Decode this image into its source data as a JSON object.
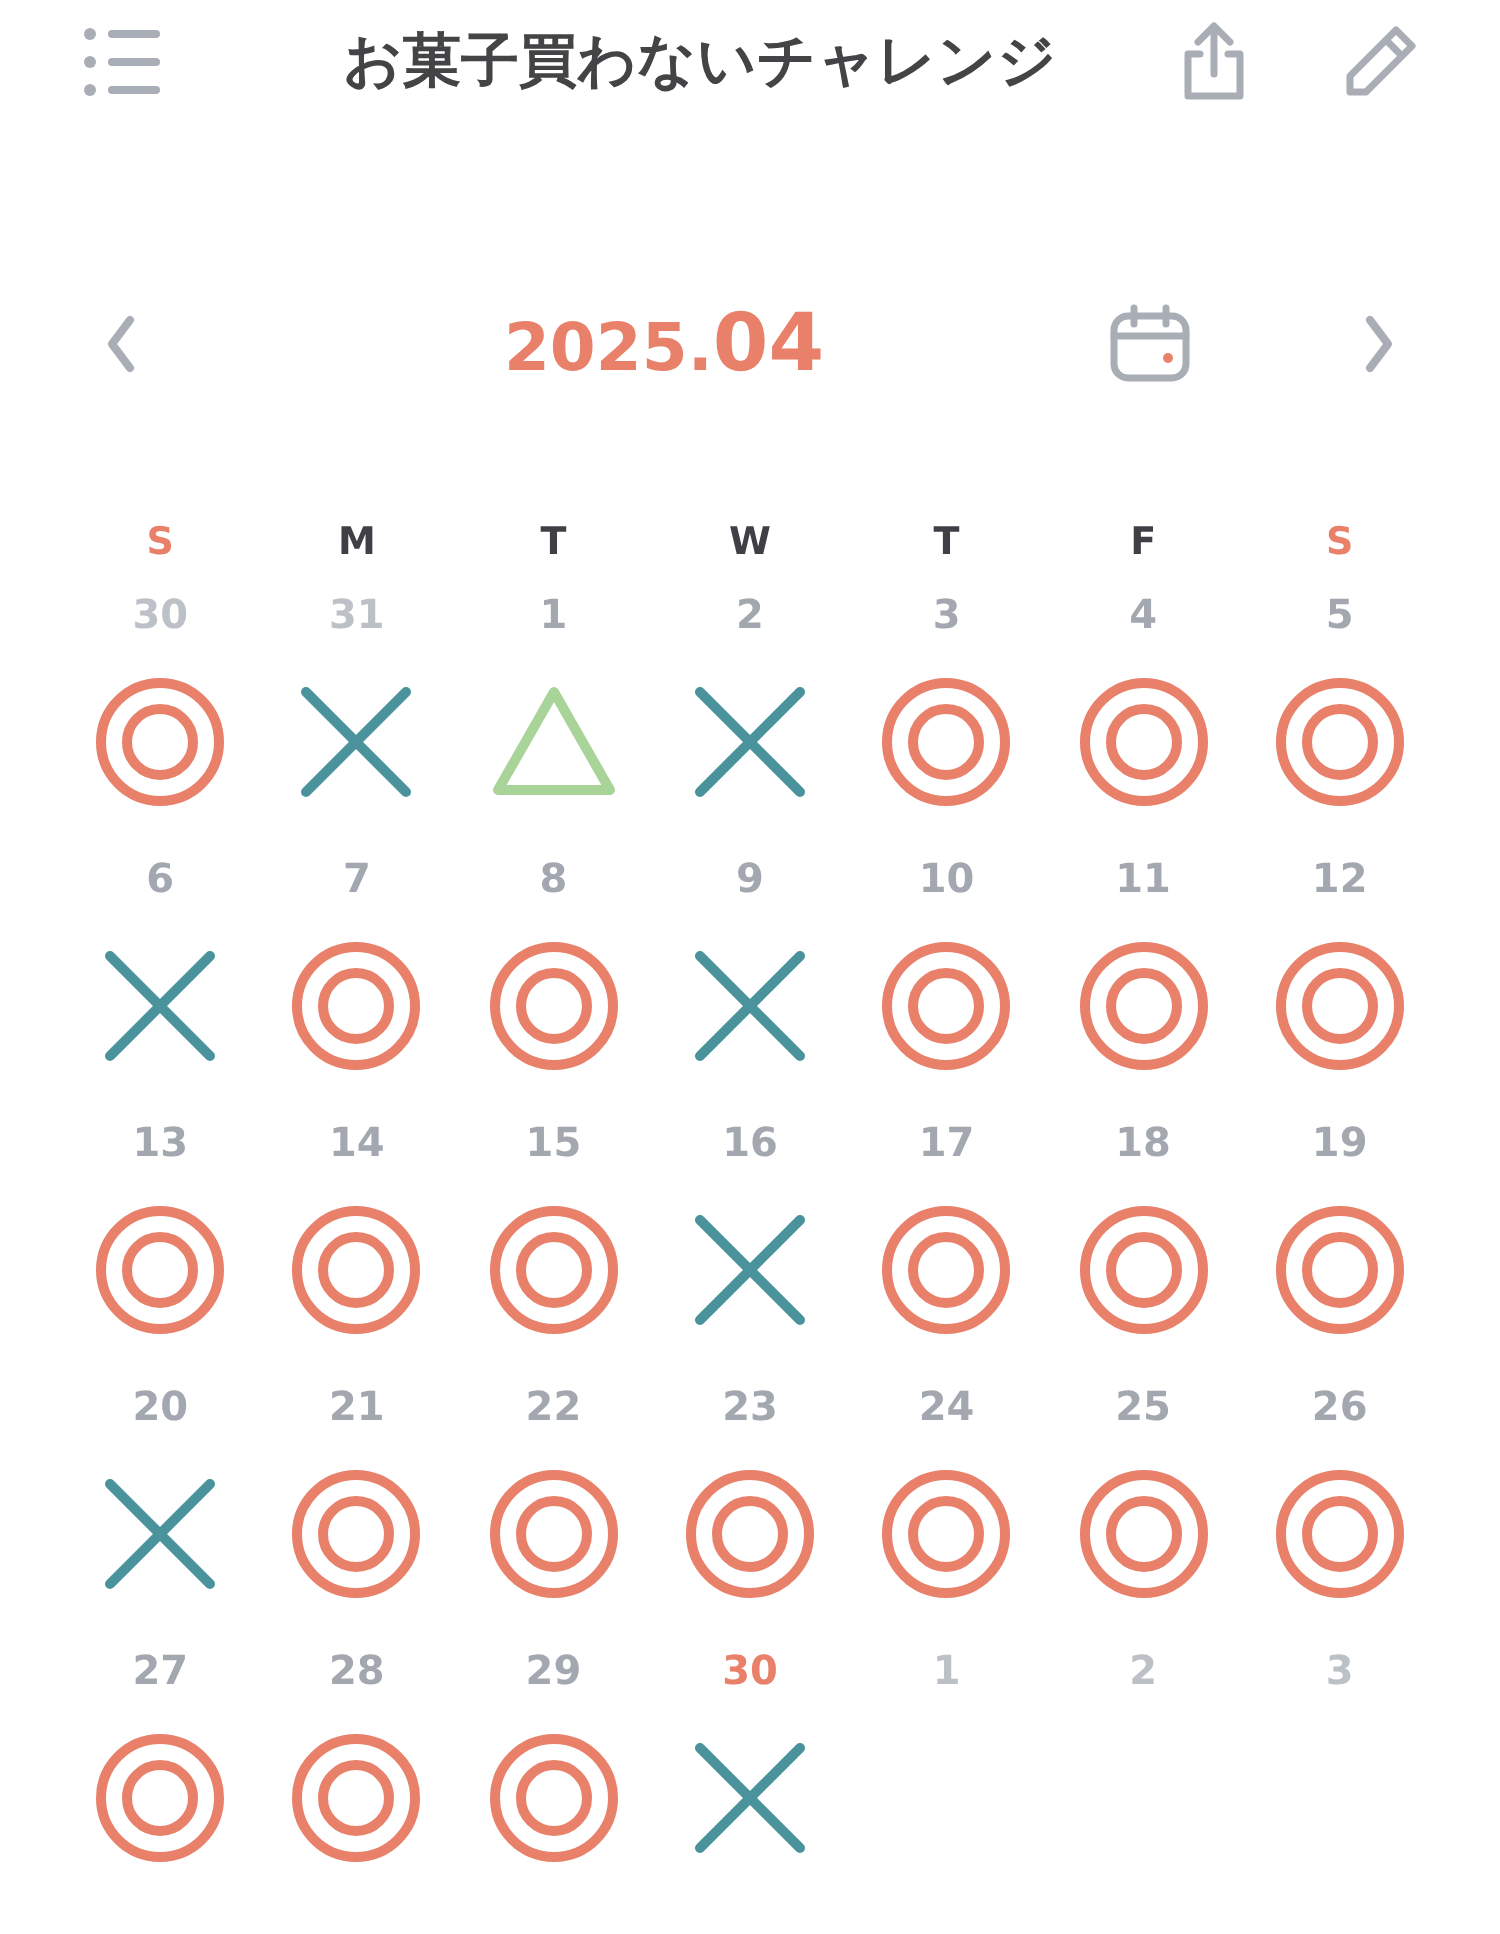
{
  "header": {
    "title": "お菓子買わないチャレンジ"
  },
  "month_nav": {
    "year": "2025.",
    "month": "04"
  },
  "weekdays": [
    {
      "label": "S",
      "color": "#e8806a"
    },
    {
      "label": "M",
      "color": "#3f3f46"
    },
    {
      "label": "T",
      "color": "#3f3f46"
    },
    {
      "label": "W",
      "color": "#3f3f46"
    },
    {
      "label": "T",
      "color": "#3f3f46"
    },
    {
      "label": "F",
      "color": "#3f3f46"
    },
    {
      "label": "S",
      "color": "#e8806a"
    }
  ],
  "days": [
    {
      "day": "30",
      "in_month": false,
      "today": false,
      "kind": "double_circle"
    },
    {
      "day": "31",
      "in_month": false,
      "today": false,
      "kind": "cross"
    },
    {
      "day": "1",
      "in_month": true,
      "today": false,
      "kind": "triangle"
    },
    {
      "day": "2",
      "in_month": true,
      "today": false,
      "kind": "cross"
    },
    {
      "day": "3",
      "in_month": true,
      "today": false,
      "kind": "double_circle"
    },
    {
      "day": "4",
      "in_month": true,
      "today": false,
      "kind": "double_circle"
    },
    {
      "day": "5",
      "in_month": true,
      "today": false,
      "kind": "double_circle"
    },
    {
      "day": "6",
      "in_month": true,
      "today": false,
      "kind": "cross"
    },
    {
      "day": "7",
      "in_month": true,
      "today": false,
      "kind": "double_circle"
    },
    {
      "day": "8",
      "in_month": true,
      "today": false,
      "kind": "double_circle"
    },
    {
      "day": "9",
      "in_month": true,
      "today": false,
      "kind": "cross"
    },
    {
      "day": "10",
      "in_month": true,
      "today": false,
      "kind": "double_circle"
    },
    {
      "day": "11",
      "in_month": true,
      "today": false,
      "kind": "double_circle"
    },
    {
      "day": "12",
      "in_month": true,
      "today": false,
      "kind": "double_circle"
    },
    {
      "day": "13",
      "in_month": true,
      "today": false,
      "kind": "double_circle"
    },
    {
      "day": "14",
      "in_month": true,
      "today": false,
      "kind": "double_circle"
    },
    {
      "day": "15",
      "in_month": true,
      "today": false,
      "kind": "double_circle"
    },
    {
      "day": "16",
      "in_month": true,
      "today": false,
      "kind": "cross"
    },
    {
      "day": "17",
      "in_month": true,
      "today": false,
      "kind": "double_circle"
    },
    {
      "day": "18",
      "in_month": true,
      "today": false,
      "kind": "double_circle"
    },
    {
      "day": "19",
      "in_month": true,
      "today": false,
      "kind": "double_circle"
    },
    {
      "day": "20",
      "in_month": true,
      "today": false,
      "kind": "cross"
    },
    {
      "day": "21",
      "in_month": true,
      "today": false,
      "kind": "double_circle"
    },
    {
      "day": "22",
      "in_month": true,
      "today": false,
      "kind": "double_circle"
    },
    {
      "day": "23",
      "in_month": true,
      "today": false,
      "kind": "double_circle"
    },
    {
      "day": "24",
      "in_month": true,
      "today": false,
      "kind": "double_circle"
    },
    {
      "day": "25",
      "in_month": true,
      "today": false,
      "kind": "double_circle"
    },
    {
      "day": "26",
      "in_month": true,
      "today": false,
      "kind": "double_circle"
    },
    {
      "day": "27",
      "in_month": true,
      "today": false,
      "kind": "double_circle"
    },
    {
      "day": "28",
      "in_month": true,
      "today": false,
      "kind": "double_circle"
    },
    {
      "day": "29",
      "in_month": true,
      "today": false,
      "kind": "double_circle"
    },
    {
      "day": "30",
      "in_month": true,
      "today": true,
      "kind": "cross"
    },
    {
      "day": "1",
      "in_month": false,
      "today": false
    },
    {
      "day": "2",
      "in_month": false,
      "today": false
    },
    {
      "day": "3",
      "in_month": false,
      "today": false
    }
  ]
}
